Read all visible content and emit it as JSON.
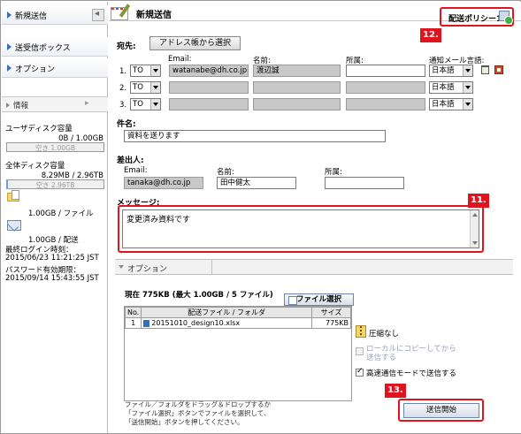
{
  "sidebar": {
    "nav": [
      {
        "label": "新規送信"
      },
      {
        "label": "送受信ボックス"
      },
      {
        "label": "オプション"
      }
    ],
    "info_title": "情報",
    "user_disk": {
      "label": "ユーザディスク容量",
      "value": "0B / 1.00GB",
      "free": "空き 1.00GB",
      "used_fraction": 0.0
    },
    "total_disk": {
      "label": "全体ディスク容量",
      "value": "8.29MB / 2.96TB",
      "free": "空き 2.96TB",
      "used_fraction": 0.01
    },
    "per_file": "1.00GB / ファイル",
    "per_send": "1.00GB / 配送",
    "last_login_label": "最終ログイン時刻：",
    "last_login": "2015/06/23 11:21:25 JST",
    "pw_expiry_label": "パスワード有効期限：",
    "pw_expiry": "2015/09/14 15:43:55 JST"
  },
  "header": {
    "title": "新規送信",
    "policy": "配送ポリシー1"
  },
  "recipients": {
    "label": "宛先:",
    "address_book_button": "アドレス帳から選択",
    "col_email": "Email:",
    "col_name": "名前:",
    "col_affiliation": "所属:",
    "col_notify_lang": "通知メール言語:",
    "rows": [
      {
        "num": "1.",
        "type": "TO",
        "email": "watanabe@dh.co.jp",
        "name": "渡辺誠",
        "affiliation": "",
        "lang": "日本語"
      },
      {
        "num": "2.",
        "type": "TO",
        "email": "",
        "name": "",
        "affiliation": "",
        "lang": "日本語"
      },
      {
        "num": "3.",
        "type": "TO",
        "email": "",
        "name": "",
        "affiliation": "",
        "lang": "日本語"
      }
    ]
  },
  "subject": {
    "label": "件名:",
    "value": "資料を送ります"
  },
  "sender": {
    "label": "差出人:",
    "email_label": "Email:",
    "email": "tanaka@dh.co.jp",
    "name_label": "名前:",
    "name": "田中健太",
    "affiliation_label": "所属:",
    "affiliation": ""
  },
  "message": {
    "label": "メッセージ:",
    "value": "変更済み資料です"
  },
  "options": {
    "tab_label": "オプション"
  },
  "attachments": {
    "summary": "現在 775KB (最大 1.00GB / 5 ファイル)",
    "select_button": "ファイル選択",
    "columns": [
      "No.",
      "配送ファイル / フォルダ",
      "サイズ"
    ],
    "rows": [
      {
        "no": "1",
        "name": "20151010_design10.xlsx",
        "size": "775KB"
      }
    ],
    "compression": "圧縮なし",
    "local_copy": "ローカルにコピーしてから送信する",
    "fast_mode": "高速通信モードで送信する",
    "help_lines": [
      "ファイル／フォルダをドラッグ＆ドロップするか",
      "「ファイル選択」ボタンでファイルを選択して、",
      "「送信開始」ボタンを押してください。"
    ],
    "send_button": "送信開始"
  },
  "callouts": {
    "policy": "12.",
    "message": "11.",
    "send": "13."
  },
  "colors": {
    "callout_red": "#e0141e",
    "nav_blue": "#3a6fb5"
  },
  "icons": [
    "compose-icon",
    "policy-icon",
    "trash-icon",
    "address-book-icon",
    "file-icon",
    "mail-icon",
    "zip-icon"
  ]
}
